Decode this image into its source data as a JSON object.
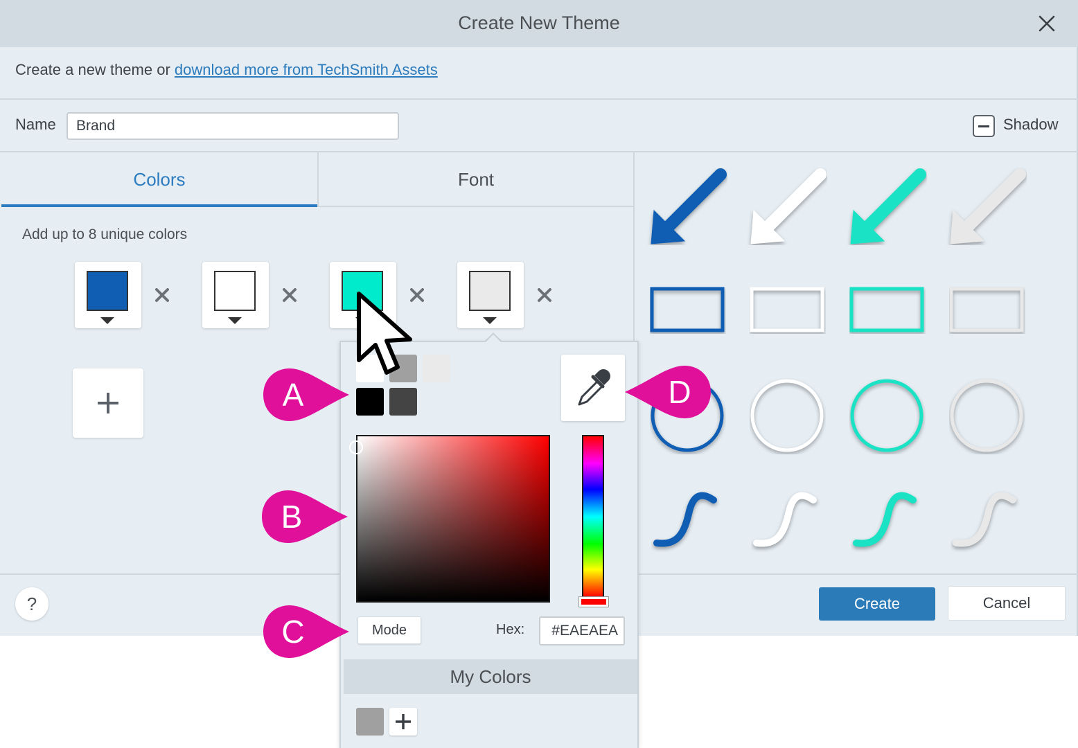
{
  "window": {
    "title": "Create New Theme"
  },
  "intro": {
    "text": "Create a new theme or ",
    "link": "download more from TechSmith Assets"
  },
  "name_field": {
    "label": "Name",
    "value": "Brand"
  },
  "shadow": {
    "label": "Shadow",
    "state": "indeterminate"
  },
  "tabs": [
    {
      "label": "Colors",
      "active": true
    },
    {
      "label": "Font",
      "active": false
    }
  ],
  "colors_panel": {
    "hint": "Add up to 8 unique colors",
    "swatches": [
      {
        "hex": "#0F5EB4"
      },
      {
        "hex": "#FFFFFF"
      },
      {
        "hex": "#00EBCC"
      },
      {
        "hex": "#EAEAEA"
      }
    ]
  },
  "preview_colors": [
    "#0F5EB4",
    "#FFFFFF",
    "#19E3C4",
    "#E8E8E8"
  ],
  "picker": {
    "presets_row1": [
      "#FFFFFF",
      "#A0A0A0",
      "#EAEAEA"
    ],
    "presets_row2": [
      "#000000",
      "#444444"
    ],
    "mode_label": "Mode",
    "hex_label": "Hex:",
    "hex_value": "#EAEAEA",
    "my_colors_title": "My Colors",
    "my_colors": [
      "#A0A0A0"
    ]
  },
  "footer": {
    "help_label": "?",
    "create_label": "Create",
    "cancel_label": "Cancel"
  },
  "callouts": {
    "a": "A",
    "b": "B",
    "c": "C",
    "d": "D",
    "color": "#E0109A"
  }
}
